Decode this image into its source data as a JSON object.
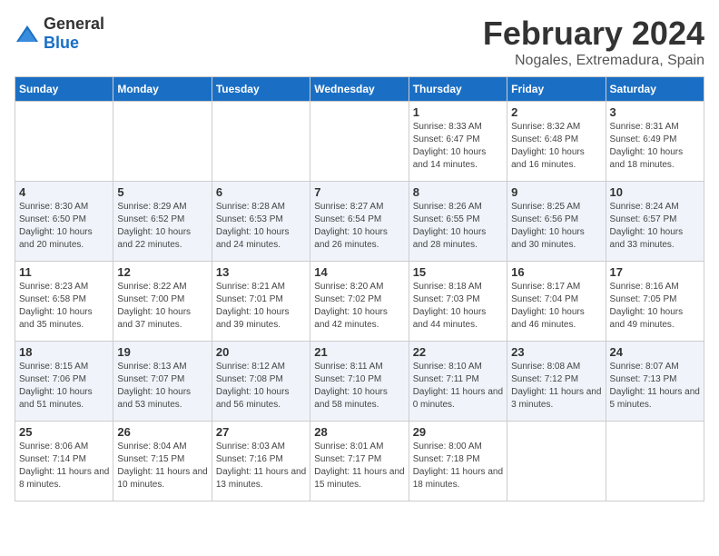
{
  "logo": {
    "text_general": "General",
    "text_blue": "Blue"
  },
  "title": "February 2024",
  "subtitle": "Nogales, Extremadura, Spain",
  "days_of_week": [
    "Sunday",
    "Monday",
    "Tuesday",
    "Wednesday",
    "Thursday",
    "Friday",
    "Saturday"
  ],
  "weeks": [
    [
      {
        "day": "",
        "text": ""
      },
      {
        "day": "",
        "text": ""
      },
      {
        "day": "",
        "text": ""
      },
      {
        "day": "",
        "text": ""
      },
      {
        "day": "1",
        "text": "Sunrise: 8:33 AM\nSunset: 6:47 PM\nDaylight: 10 hours and 14 minutes."
      },
      {
        "day": "2",
        "text": "Sunrise: 8:32 AM\nSunset: 6:48 PM\nDaylight: 10 hours and 16 minutes."
      },
      {
        "day": "3",
        "text": "Sunrise: 8:31 AM\nSunset: 6:49 PM\nDaylight: 10 hours and 18 minutes."
      }
    ],
    [
      {
        "day": "4",
        "text": "Sunrise: 8:30 AM\nSunset: 6:50 PM\nDaylight: 10 hours and 20 minutes."
      },
      {
        "day": "5",
        "text": "Sunrise: 8:29 AM\nSunset: 6:52 PM\nDaylight: 10 hours and 22 minutes."
      },
      {
        "day": "6",
        "text": "Sunrise: 8:28 AM\nSunset: 6:53 PM\nDaylight: 10 hours and 24 minutes."
      },
      {
        "day": "7",
        "text": "Sunrise: 8:27 AM\nSunset: 6:54 PM\nDaylight: 10 hours and 26 minutes."
      },
      {
        "day": "8",
        "text": "Sunrise: 8:26 AM\nSunset: 6:55 PM\nDaylight: 10 hours and 28 minutes."
      },
      {
        "day": "9",
        "text": "Sunrise: 8:25 AM\nSunset: 6:56 PM\nDaylight: 10 hours and 30 minutes."
      },
      {
        "day": "10",
        "text": "Sunrise: 8:24 AM\nSunset: 6:57 PM\nDaylight: 10 hours and 33 minutes."
      }
    ],
    [
      {
        "day": "11",
        "text": "Sunrise: 8:23 AM\nSunset: 6:58 PM\nDaylight: 10 hours and 35 minutes."
      },
      {
        "day": "12",
        "text": "Sunrise: 8:22 AM\nSunset: 7:00 PM\nDaylight: 10 hours and 37 minutes."
      },
      {
        "day": "13",
        "text": "Sunrise: 8:21 AM\nSunset: 7:01 PM\nDaylight: 10 hours and 39 minutes."
      },
      {
        "day": "14",
        "text": "Sunrise: 8:20 AM\nSunset: 7:02 PM\nDaylight: 10 hours and 42 minutes."
      },
      {
        "day": "15",
        "text": "Sunrise: 8:18 AM\nSunset: 7:03 PM\nDaylight: 10 hours and 44 minutes."
      },
      {
        "day": "16",
        "text": "Sunrise: 8:17 AM\nSunset: 7:04 PM\nDaylight: 10 hours and 46 minutes."
      },
      {
        "day": "17",
        "text": "Sunrise: 8:16 AM\nSunset: 7:05 PM\nDaylight: 10 hours and 49 minutes."
      }
    ],
    [
      {
        "day": "18",
        "text": "Sunrise: 8:15 AM\nSunset: 7:06 PM\nDaylight: 10 hours and 51 minutes."
      },
      {
        "day": "19",
        "text": "Sunrise: 8:13 AM\nSunset: 7:07 PM\nDaylight: 10 hours and 53 minutes."
      },
      {
        "day": "20",
        "text": "Sunrise: 8:12 AM\nSunset: 7:08 PM\nDaylight: 10 hours and 56 minutes."
      },
      {
        "day": "21",
        "text": "Sunrise: 8:11 AM\nSunset: 7:10 PM\nDaylight: 10 hours and 58 minutes."
      },
      {
        "day": "22",
        "text": "Sunrise: 8:10 AM\nSunset: 7:11 PM\nDaylight: 11 hours and 0 minutes."
      },
      {
        "day": "23",
        "text": "Sunrise: 8:08 AM\nSunset: 7:12 PM\nDaylight: 11 hours and 3 minutes."
      },
      {
        "day": "24",
        "text": "Sunrise: 8:07 AM\nSunset: 7:13 PM\nDaylight: 11 hours and 5 minutes."
      }
    ],
    [
      {
        "day": "25",
        "text": "Sunrise: 8:06 AM\nSunset: 7:14 PM\nDaylight: 11 hours and 8 minutes."
      },
      {
        "day": "26",
        "text": "Sunrise: 8:04 AM\nSunset: 7:15 PM\nDaylight: 11 hours and 10 minutes."
      },
      {
        "day": "27",
        "text": "Sunrise: 8:03 AM\nSunset: 7:16 PM\nDaylight: 11 hours and 13 minutes."
      },
      {
        "day": "28",
        "text": "Sunrise: 8:01 AM\nSunset: 7:17 PM\nDaylight: 11 hours and 15 minutes."
      },
      {
        "day": "29",
        "text": "Sunrise: 8:00 AM\nSunset: 7:18 PM\nDaylight: 11 hours and 18 minutes."
      },
      {
        "day": "",
        "text": ""
      },
      {
        "day": "",
        "text": ""
      }
    ]
  ]
}
